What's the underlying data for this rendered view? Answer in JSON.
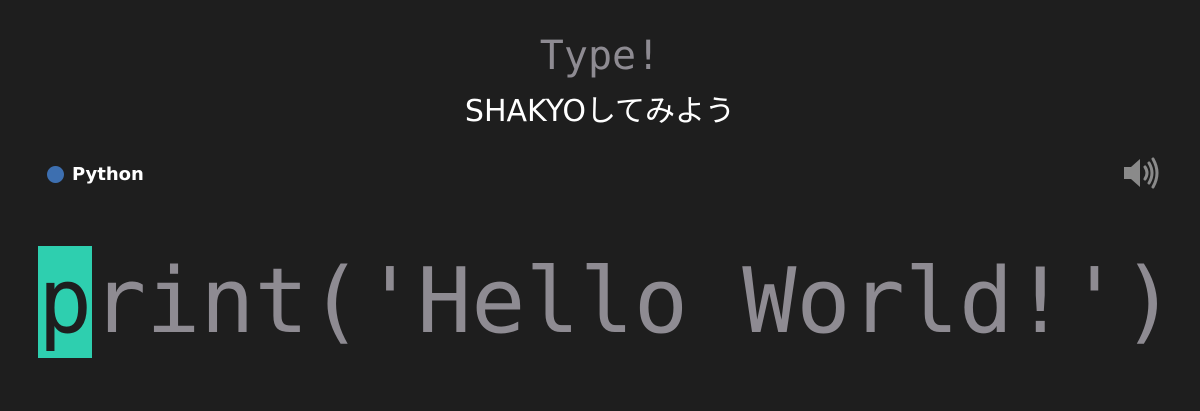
{
  "header": {
    "title": "Type!",
    "subtitle": "SHAKYOしてみよう"
  },
  "language": {
    "label": "Python",
    "dot_color": "#3d6fb0"
  },
  "sound": {
    "icon": "speaker-volume-icon"
  },
  "typing": {
    "current_char": "p",
    "remaining_text": "rint('Hello World!')",
    "cursor_color": "#2ecfaf",
    "text_color": "#8e8b92"
  }
}
